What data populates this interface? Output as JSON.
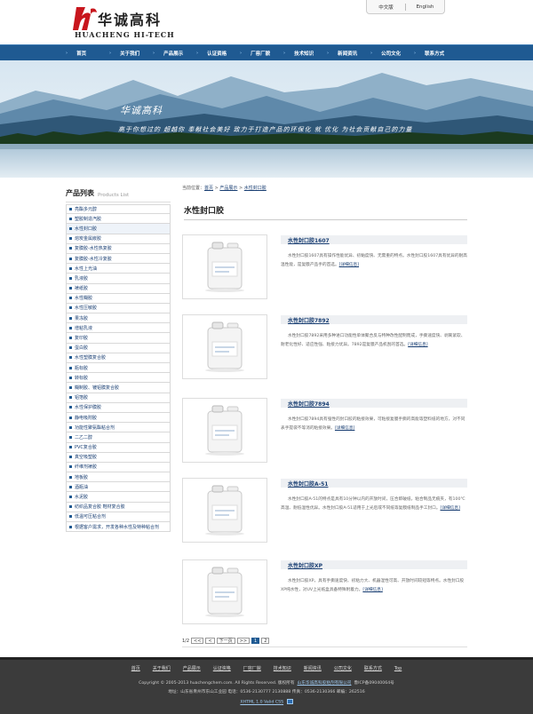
{
  "brand": {
    "cn": "华诚高科",
    "en": "HUACHENG HI-TECH"
  },
  "lang": {
    "cn": "中文版",
    "en": "English"
  },
  "nav": [
    "首页",
    "关于我们",
    "产品展示",
    "认证资格",
    "厂容厂貌",
    "技术知识",
    "新闻资讯",
    "公司文化",
    "联系方式"
  ],
  "banner": {
    "title": "华诚高科",
    "slogan": "高于你想过的 超越你 奉献社会美好 致力于打造产品的环保化 就 优化 为社会贡献自己的力量"
  },
  "sidebar": {
    "title_cn": "产品列表",
    "title_en": "Products List",
    "items": [
      "亮酯多元醇",
      "塑胶制造汽胶",
      "水性封口胶",
      "熔炭金属嵌胶",
      "复膜胶-水性热复胶",
      "复膜胶-水性冷复胶",
      "水性上光油",
      "乳液胶",
      "裱纸胶",
      "水性糊胶",
      "水性压敏胶",
      "果冻胶",
      "增粘乳液",
      "复印胶",
      "蛋白胶",
      "水性塑膜复合胶",
      "瓶标胶",
      "转标胶",
      "糊制胶、镀铝膜复合胶",
      "铝箔胶",
      "水性保护膜胶",
      "静电吸附胶",
      "功能性聚氨酯粘合剂",
      "二乙二醇",
      "PVC复合胶",
      "真空吸塑胶",
      "纤维剂裱胶",
      "地板胶",
      "酒瓶油",
      "水泥胶",
      "纺织品复合胶 鞋材复合胶",
      "低温可压粘合剂",
      "根据客户需求，开发各种水性及特种粘合剂"
    ],
    "active": 2
  },
  "breadcrumb": {
    "prefix": "当前位置：",
    "home": "首页",
    "sep1": " > ",
    "cat": "产品展示",
    "sep2": " > ",
    "cur": "水性封口胶"
  },
  "page_title": "水性封口胶",
  "products": [
    {
      "name": "水性封口胶1607",
      "desc": "水性封口胶1607具有操作性能优异、初黏度快、无需重的特点。水性封口胶1607具有优异的耐高温性能，是复膜产品手的首选。",
      "more": "[详细信息]"
    },
    {
      "name": "水性封口胶7892",
      "desc": "水性封口胶7892采用多种进口功能性单体聚合反与特种改性配制而成，手撕速度快、剥离紧软、耐老化性好、适应性强、粘接力优异。7892是复膜产品机刮的首选。",
      "more": "[详细信息]"
    },
    {
      "name": "水性封口胶7894",
      "desc": "水性封口胶7894具有强性的封口胶的粘接效果，可粘接复膜手撕的高能等塑料纸的地方，对不同表手提袋不等消的粘接效果。",
      "more": "[详细信息]"
    },
    {
      "name": "水性封口胶A-51",
      "desc": "水性封口胶A-51的特点是具有10分钟以内的开放时间，压合即破纸，粘合制品无痕夹，有100℃高温、耐低温性优异。水性封口胶A-51适用于上光后或不同纸等复膜纸制品手工封口。",
      "more": "[详细信息]"
    },
    {
      "name": "水性封口胶XP",
      "desc": "水性封口胶XP，具有手撕速度快、初粘力大、机器湿性可高、开放时间较短等特点。水性封口胶XP纯水性，对UV上光纸盒具备特殊附着力。",
      "more": "[详细信息]"
    }
  ],
  "pager": {
    "info": "1/2",
    "first": "<<",
    "prev": "<",
    "next": "下一页",
    "last": ">>",
    "cur": "1",
    "page2": "2"
  },
  "footer": {
    "links": [
      "首页",
      "关于我们",
      "产品展示",
      "认证资格",
      "厂容厂貌",
      "技术知识",
      "新闻资讯",
      "公司文化",
      "联系方式",
      "Top"
    ],
    "copyright": "Copyright © 2005-2013 huachengchem.com. All Rights Reserved.  版权所有",
    "company": "山东华诚高科胶粘剂有限公司",
    "icp": "鲁ICP备09040064号",
    "address": "地址：山东省青州市东山工业园  电话：0536-2130777 2130888 传真：0536-2130366 邮编：262516",
    "validator": "XHTML 1.0 Valid CSS"
  },
  "colors": {
    "nav": "#1f5a92",
    "link": "#1a3f73",
    "footer": "#3b3b3b"
  }
}
